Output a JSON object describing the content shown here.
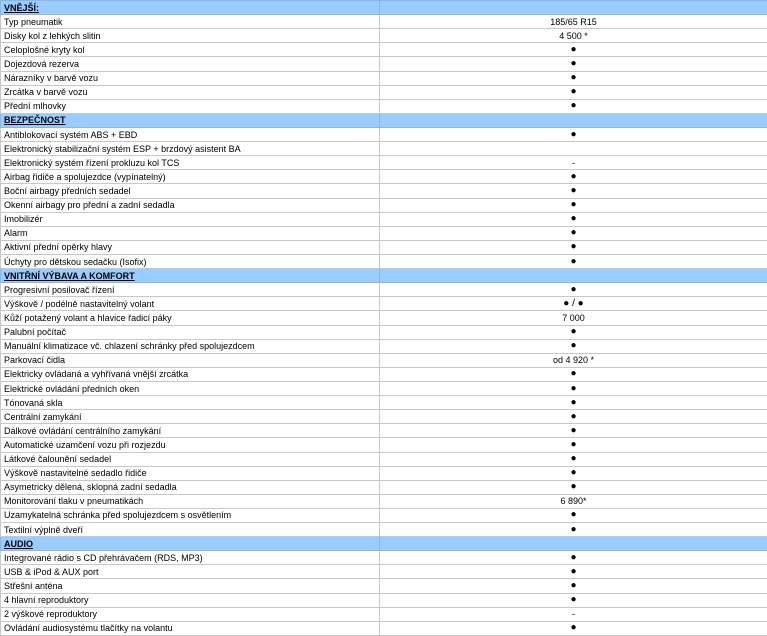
{
  "sections": [
    {
      "title": "VNĚJŠÍ:",
      "rows": [
        {
          "label": "Typ pneumatik",
          "value": "185/65 R15"
        },
        {
          "label": "Disky kol z lehkých slitin",
          "value": "4 500 *"
        },
        {
          "label": "Celoplošné kryty kol",
          "value": "●"
        },
        {
          "label": "Dojezdová rezerva",
          "value": "●"
        },
        {
          "label": "Nárazníky v barvě vozu",
          "value": "●"
        },
        {
          "label": "Zrcátka  v barvě vozu",
          "value": "●"
        },
        {
          "label": "Přední mlhovky",
          "value": "●"
        }
      ]
    },
    {
      "title": "BEZPEČNOST",
      "rows": [
        {
          "label": "Antiblokovací systém ABS + EBD",
          "value": "●"
        },
        {
          "label": "Elektronický stabilizační systém ESP + brzdový asistent BA",
          "value": ""
        },
        {
          "label": "Elektronický systém řízení prokluzu kol TCS",
          "value": "-"
        },
        {
          "label": "Airbag řidiče a spolujezdce (vypínatelný)",
          "value": "●"
        },
        {
          "label": "Boční airbagy předních sedadel",
          "value": "●"
        },
        {
          "label": "Okenní airbagy pro přední a zadní sedadla",
          "value": "●"
        },
        {
          "label": "Imobilizér",
          "value": "●"
        },
        {
          "label": "Alarm",
          "value": "●"
        },
        {
          "label": "Aktivní přední opěrky hlavy",
          "value": "●"
        },
        {
          "label": "Úchyty pro dětskou sedačku (Isofix)",
          "value": "●"
        }
      ]
    },
    {
      "title": "VNITŘNÍ VÝBAVA A KOMFORT",
      "rows": [
        {
          "label": "Progresivní posilovač řízení",
          "value": "●"
        },
        {
          "label": "Výškově / podélně nastavitelný volant",
          "value": "● / ●"
        },
        {
          "label": "Kůží potažený volant a hlavice řadicí páky",
          "value": "7 000"
        },
        {
          "label": "Palubní počítač",
          "value": "●"
        },
        {
          "label": "Manuální klimatizace vč. chlazení schránky před spolujezdcem",
          "value": "●"
        },
        {
          "label": "Parkovací čidla",
          "value": "od 4 920 *"
        },
        {
          "label": "Elektricky ovládaná a vyhřívaná vnější zrcátka",
          "value": "●"
        },
        {
          "label": "Elektrické ovládání  předních oken",
          "value": "●"
        },
        {
          "label": "Tónovaná skla",
          "value": "●"
        },
        {
          "label": "Centrální zamykání",
          "value": "●"
        },
        {
          "label": "Dálkové ovládání centrálního zamykání",
          "value": "●"
        },
        {
          "label": "Automatické uzamčení vozu při rozjezdu",
          "value": "●"
        },
        {
          "label": "Látkové čalounění sedadel",
          "value": "●"
        },
        {
          "label": "Výškově nastavitelné sedadlo řidiče",
          "value": "●"
        },
        {
          "label": "Asymetricky dělená, sklopná zadní sedadla",
          "value": "●"
        },
        {
          "label": "Monitorování tlaku v pneumatikách",
          "value": "6 890*"
        },
        {
          "label": "Uzamykatelná schránka před spolujezdcem s osvětlením",
          "value": "●"
        },
        {
          "label": "Textilní výplně dveří",
          "value": "●"
        }
      ]
    },
    {
      "title": "AUDIO",
      "rows": [
        {
          "label": "Integrované rádio s CD přehrávačem (RDS, MP3)",
          "value": "●"
        },
        {
          "label": "USB & iPod & AUX port",
          "value": "●"
        },
        {
          "label": "Střešní anténa",
          "value": "●"
        },
        {
          "label": "4 hlavní reproduktory",
          "value": "●"
        },
        {
          "label": "2 výškové reproduktory",
          "value": "-"
        },
        {
          "label": "Ovládání audiosystému tlačítky na volantu",
          "value": "●"
        }
      ]
    }
  ]
}
